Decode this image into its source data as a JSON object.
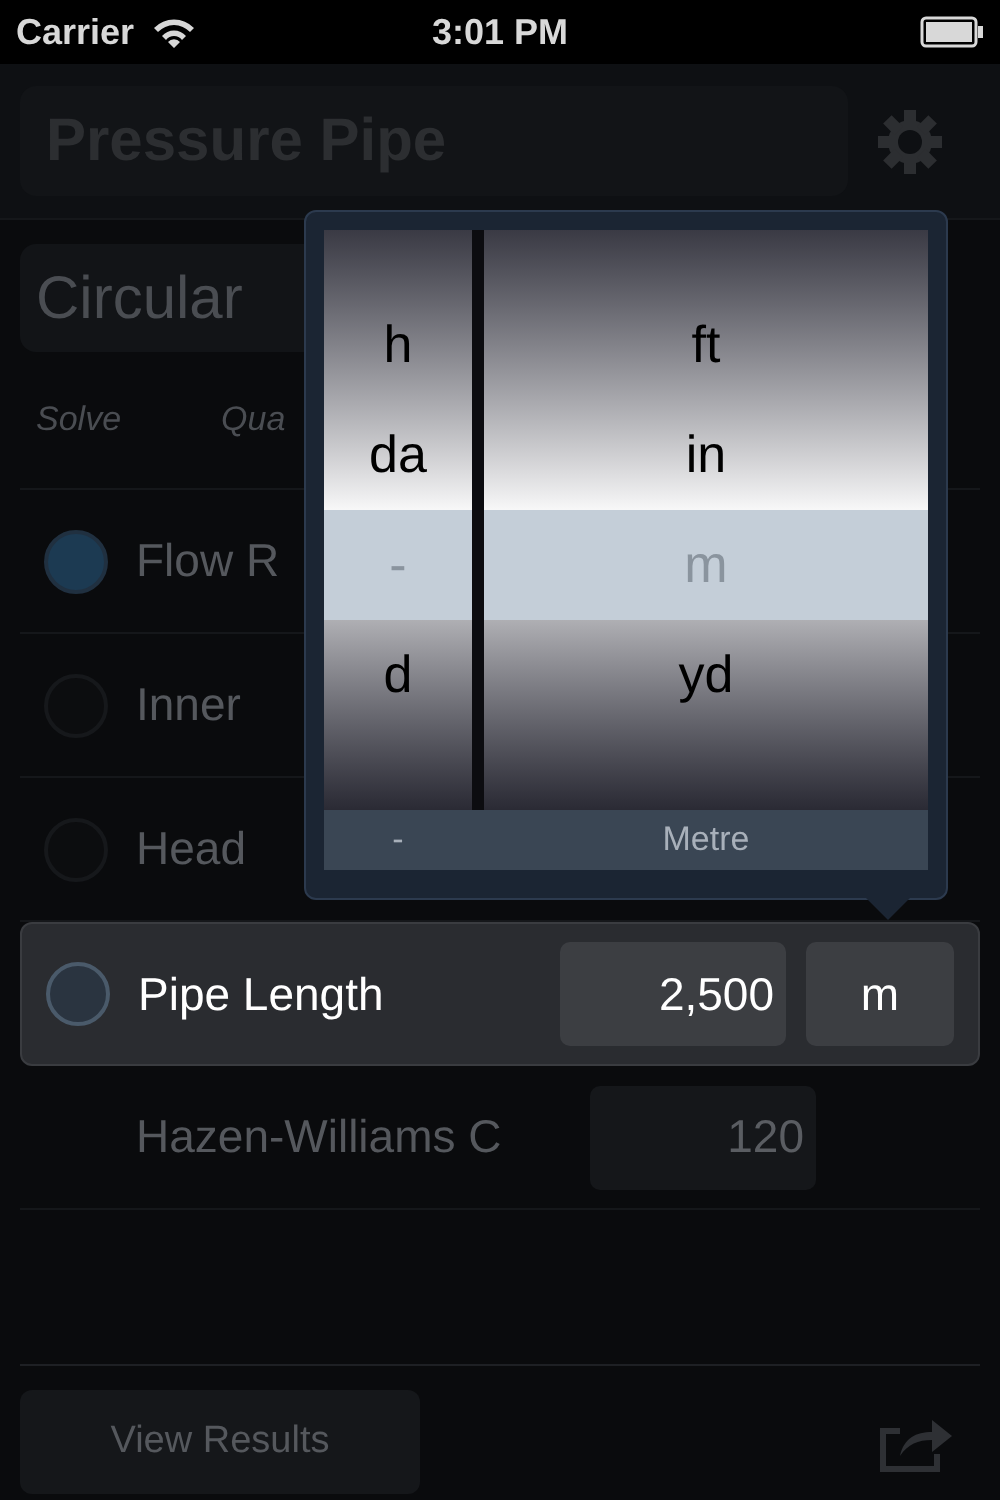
{
  "status_bar": {
    "carrier": "Carrier",
    "time": "3:01 PM"
  },
  "header": {
    "title": "Pressure Pipe"
  },
  "shape": {
    "value": "Circular"
  },
  "column_headers": [
    "Solve",
    "Qua"
  ],
  "rows": [
    {
      "kind": "solve",
      "label": "Flow R",
      "selected": true,
      "active": false
    },
    {
      "kind": "solve",
      "label": "Inner",
      "selected": false,
      "active": false
    },
    {
      "kind": "solve",
      "label": "Head",
      "selected": false,
      "active": false
    },
    {
      "kind": "solve",
      "label": "Pipe Length",
      "selected": false,
      "active": true,
      "value": "2,500",
      "unit": "m"
    },
    {
      "kind": "constant",
      "label": "Hazen-Williams C",
      "active": false,
      "value": "120"
    }
  ],
  "picker": {
    "columns": [
      {
        "items": [
          {
            "label": "h",
            "selected": false
          },
          {
            "label": "da",
            "selected": false
          },
          {
            "label": "-",
            "selected": true
          },
          {
            "label": "d",
            "selected": false
          }
        ],
        "footer": "-"
      },
      {
        "items": [
          {
            "label": "ft",
            "selected": false
          },
          {
            "label": "in",
            "selected": false
          },
          {
            "label": "m",
            "selected": true
          },
          {
            "label": "yd",
            "selected": false
          }
        ],
        "footer": "Metre"
      }
    ]
  },
  "view_results": {
    "label": "View Results"
  }
}
